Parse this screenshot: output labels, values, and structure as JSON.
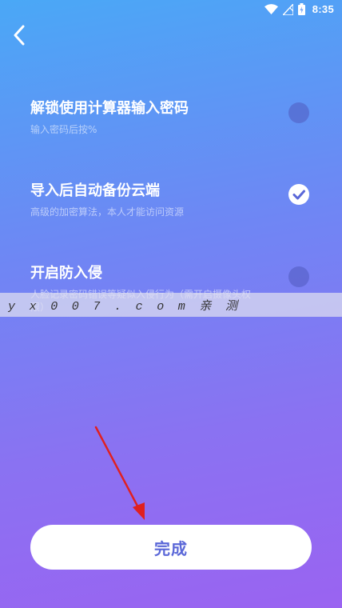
{
  "status_bar": {
    "time": "8:35",
    "icons": [
      "wifi-icon",
      "signal-icon",
      "battery-icon"
    ]
  },
  "header": {
    "back_icon": "chevron-left-icon"
  },
  "settings": [
    {
      "title": "解锁使用计算器输入密码",
      "description": "输入密码后按%",
      "enabled": false
    },
    {
      "title": "导入后自动备份云端",
      "description": "高级的加密算法，本人才能访问资源",
      "enabled": true
    },
    {
      "title": "开启防入侵",
      "description": "人脸记录密码错误等疑似入侵行为（需开启摄像头权限）",
      "enabled": false
    }
  ],
  "watermark": {
    "text": "yx007.com亲测"
  },
  "footer": {
    "done_label": "完成"
  },
  "colors": {
    "gradient_top": "#4aa8f6",
    "gradient_bottom": "#9a63f1",
    "accent": "#5a67d8",
    "arrow": "#e02020"
  }
}
